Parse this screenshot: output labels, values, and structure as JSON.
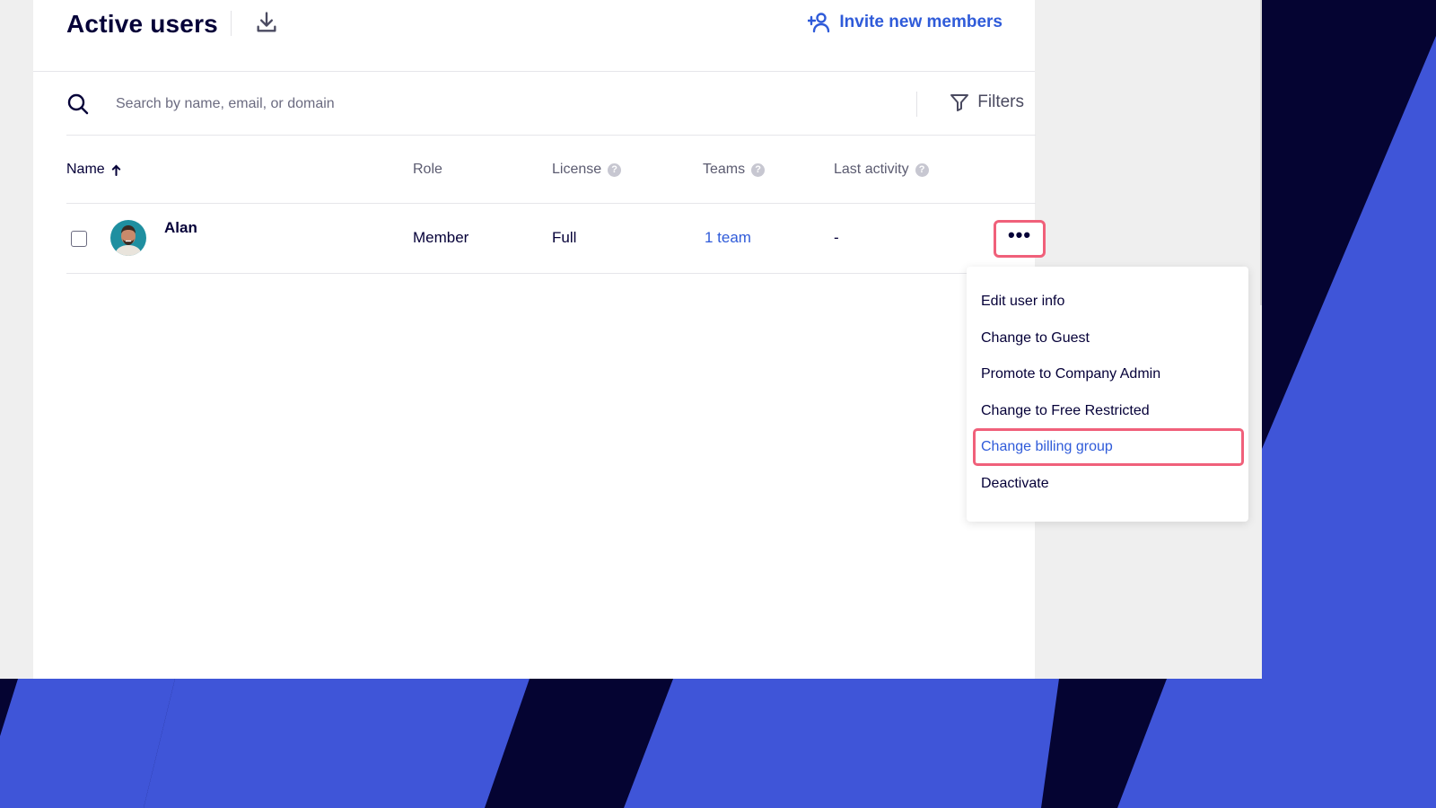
{
  "header": {
    "title": "Active users",
    "invite_label": "Invite new members"
  },
  "search": {
    "placeholder": "Search by name, email, or domain",
    "filters_label": "Filters"
  },
  "columns": {
    "name": "Name",
    "role": "Role",
    "license": "License",
    "teams": "Teams",
    "last_activity": "Last activity",
    "help_glyph": "?"
  },
  "rows": [
    {
      "name": "Alan",
      "role": "Member",
      "license": "Full",
      "teams": "1 team",
      "last_activity": "-"
    }
  ],
  "more_button": {
    "glyph": "•••"
  },
  "menu": {
    "items": [
      "Edit user info",
      "Change to Guest",
      "Promote to Company Admin",
      "Change to Free Restricted",
      "Change billing group",
      "Deactivate"
    ],
    "highlighted_index": 4
  },
  "colors": {
    "brand_blue": "#2f5bd9",
    "highlight_red": "#f0607a",
    "text_dark": "#050038",
    "background_navy": "#050432",
    "background_blue": "#3f55d8"
  },
  "icons": [
    "download-icon",
    "add-user-icon",
    "search-icon",
    "filter-icon",
    "sort-arrow-up-icon",
    "help-icon",
    "more-icon"
  ]
}
